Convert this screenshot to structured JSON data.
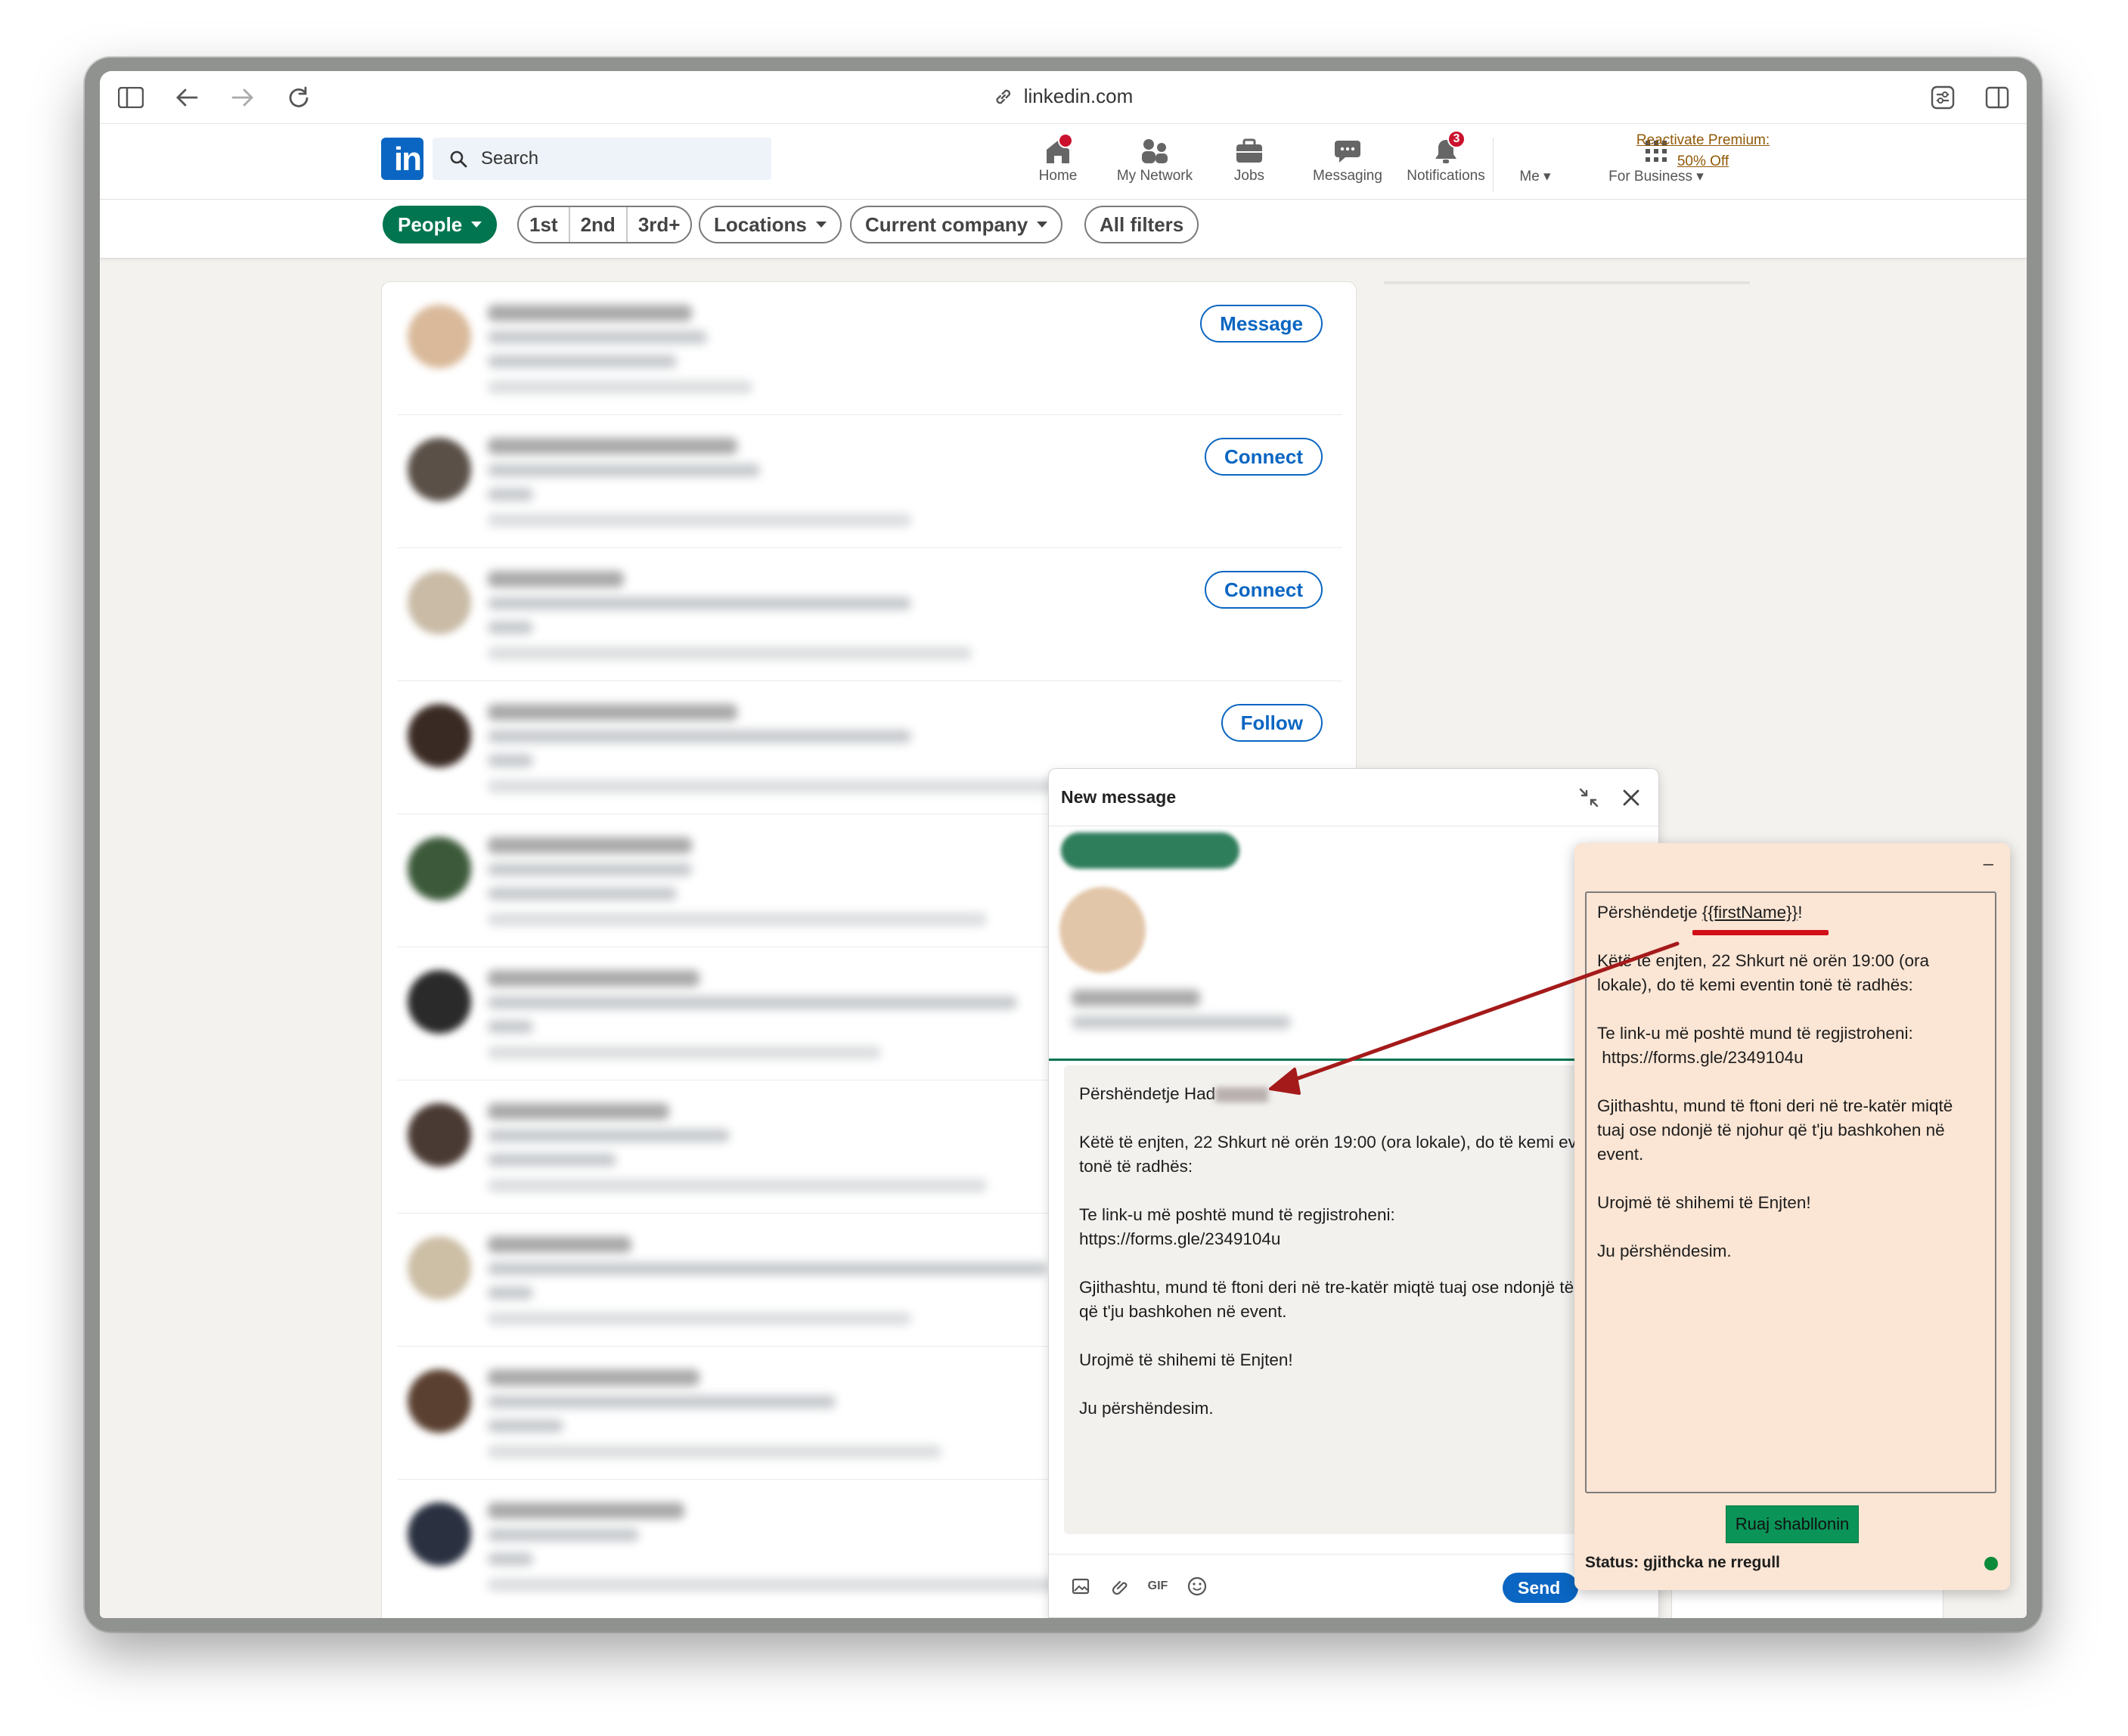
{
  "browser": {
    "url": "linkedin.com"
  },
  "header": {
    "logo": "in",
    "search_placeholder": "Search",
    "nav": [
      {
        "label": "Home",
        "icon": "home-icon",
        "badge": ""
      },
      {
        "label": "My Network",
        "icon": "network-icon",
        "badge": ""
      },
      {
        "label": "Jobs",
        "icon": "briefcase-icon",
        "badge": ""
      },
      {
        "label": "Messaging",
        "icon": "messaging-icon",
        "badge": ""
      },
      {
        "label": "Notifications",
        "icon": "bell-icon",
        "badge": "3"
      },
      {
        "label": "Me",
        "icon": "avatar-icon",
        "badge": ""
      },
      {
        "label": "For Business",
        "icon": "grid-icon",
        "badge": ""
      }
    ],
    "premium": "Reactivate Premium: 50% Off"
  },
  "filters": {
    "people": "People",
    "degrees": [
      "1st",
      "2nd",
      "3rd+"
    ],
    "locations": "Locations",
    "company": "Current company",
    "all": "All filters"
  },
  "results": {
    "buttons": [
      "Message",
      "Connect",
      "Connect",
      "Follow"
    ]
  },
  "message": {
    "title": "New message",
    "greeting": "Përshëndetje Had",
    "body": "\n\nKëtë të enjten, 22 Shkurt në orën 19:00 (ora lokale), do të kemi eventin tonë të radhës:\n\nTe link-u më poshtë mund të regjistroheni:\nhttps://forms.gle/2349104u\n\nGjithashtu, mund të ftoni deri në tre-katër miqtë tuaj ose ndonjë të njohur që t'ju bashkohen në event.\n\nUrojmë të shihemi të Enjten!\n\nJu përshëndesim.",
    "send": "Send",
    "footer_icons": [
      "image-icon",
      "attachment-icon",
      "gif-icon",
      "emoji-icon"
    ],
    "gif_label": "GIF"
  },
  "extension": {
    "minimize": "–",
    "template_greeting_prefix": "Përshëndetje ",
    "template_token": "{{firstName}}",
    "template_greeting_suffix": "!",
    "template_body": "\n\nKëtë të enjten, 22 Shkurt në orën 19:00 (ora lokale), do të kemi eventin tonë të radhës:\n\nTe link-u më poshtë mund të regjistroheni:\n https://forms.gle/2349104u\n\nGjithashtu, mund të ftoni deri në tre-katër miqtë tuaj ose ndonjë të njohur që t'ju bashkohen në event.\n\nUrojmë të shihemi të Enjten!\n\nJu përshëndesim.",
    "save_label": "Ruaj shabllonin",
    "status": "Status: gjithcka ne rregull",
    "status_color": "#0b8a3a"
  },
  "colors": {
    "brand": "#0a66c2",
    "green": "#01754f",
    "annotation": "#a41a1a"
  }
}
